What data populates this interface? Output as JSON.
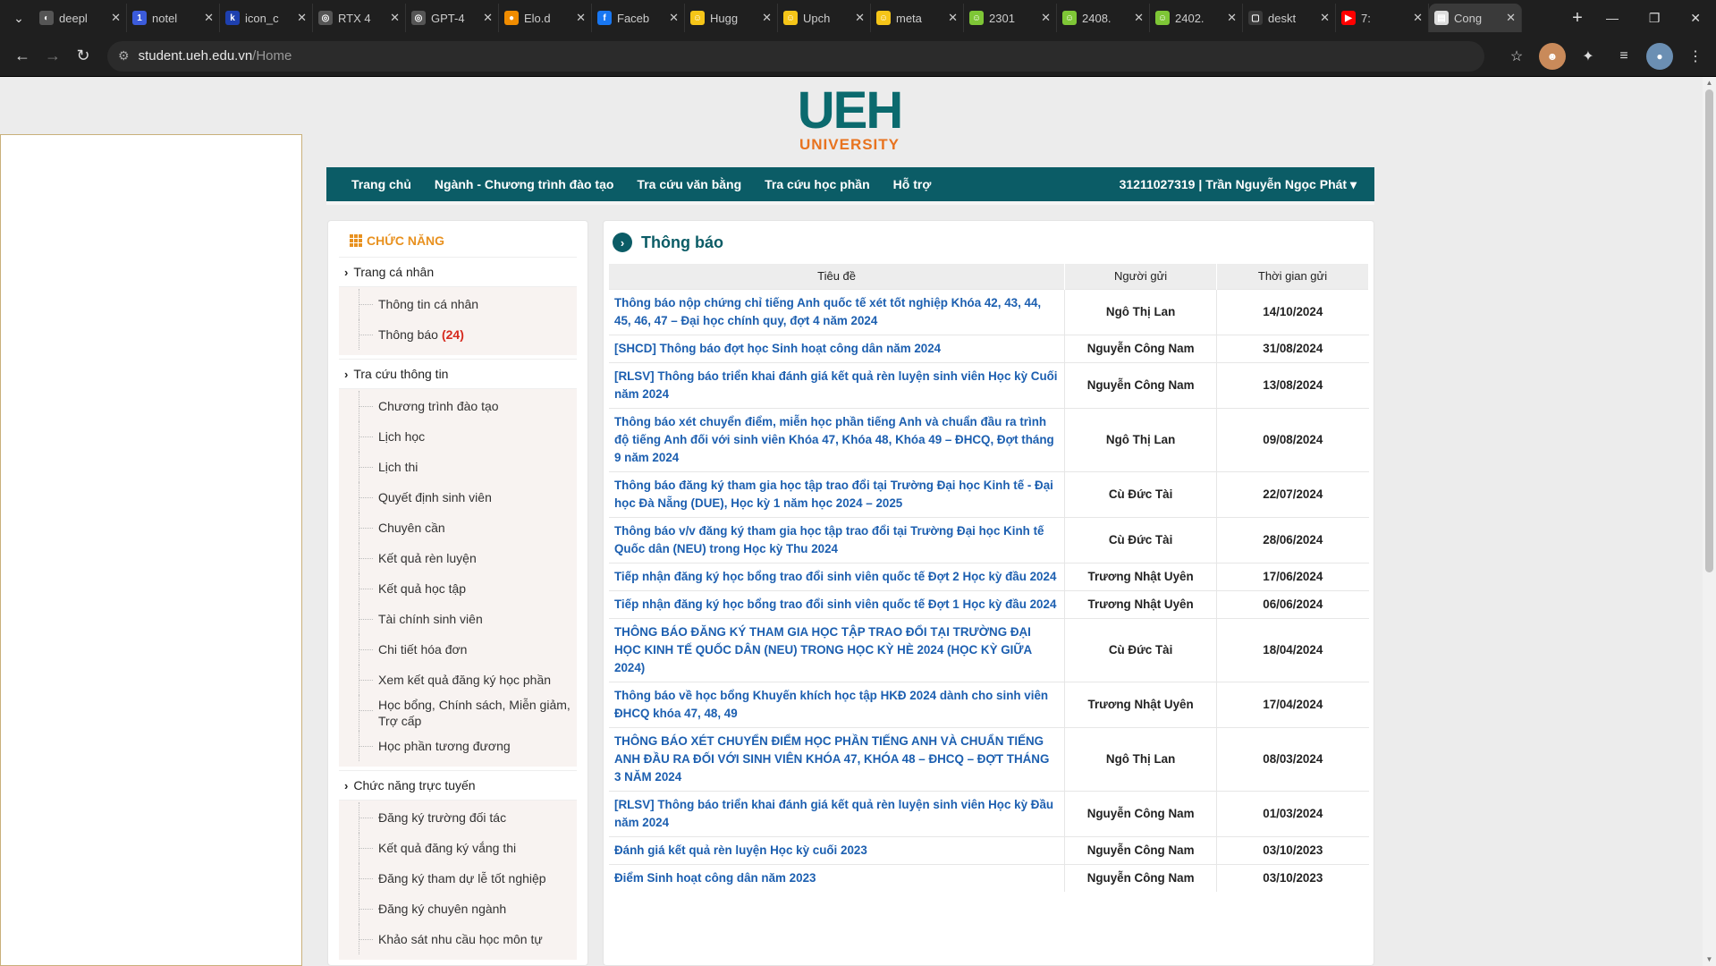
{
  "browser": {
    "tabs": [
      {
        "title": "deepl",
        "icon_color": "#555555",
        "icon_glyph": "◐"
      },
      {
        "title": "notel",
        "icon_color": "#3b5bdb",
        "icon_glyph": "1"
      },
      {
        "title": "icon_c",
        "icon_color": "#1e40af",
        "icon_glyph": "k"
      },
      {
        "title": "RTX 4",
        "icon_color": "#555555",
        "icon_glyph": "◎"
      },
      {
        "title": "GPT-4",
        "icon_color": "#555555",
        "icon_glyph": "◎"
      },
      {
        "title": "Elo.d",
        "icon_color": "#f08c00",
        "icon_glyph": "●"
      },
      {
        "title": "Faceb",
        "icon_color": "#1877f2",
        "icon_glyph": "f"
      },
      {
        "title": "Hugg",
        "icon_color": "#f5c518",
        "icon_glyph": "☺"
      },
      {
        "title": "Upch",
        "icon_color": "#f5c518",
        "icon_glyph": "☺"
      },
      {
        "title": "meta",
        "icon_color": "#f5c518",
        "icon_glyph": "☺"
      },
      {
        "title": "2301",
        "icon_color": "#7ec636",
        "icon_glyph": "☺"
      },
      {
        "title": "2408.",
        "icon_color": "#7ec636",
        "icon_glyph": "☺"
      },
      {
        "title": "2402.",
        "icon_color": "#7ec636",
        "icon_glyph": "☺"
      },
      {
        "title": "deskt",
        "icon_color": "#3a3a3a",
        "icon_glyph": "▢"
      },
      {
        "title": "7:",
        "icon_color": "#ff0000",
        "icon_glyph": "▶"
      },
      {
        "title": "Cong",
        "icon_color": "#dddddd",
        "icon_glyph": "▤"
      }
    ],
    "active_tab_index": 15,
    "url_host": "student.ueh.edu.vn",
    "url_path": "/Home"
  },
  "logo": {
    "line1": "UEH",
    "line2": "UNIVERSITY"
  },
  "nav": {
    "items": [
      "Trang chủ",
      "Ngành - Chương trình đào tạo",
      "Tra cứu văn bằng",
      "Tra cứu học phần",
      "Hỗ trợ"
    ],
    "user": "31211027319 | Trần Nguyễn Ngọc Phát"
  },
  "sidebar": {
    "title": "CHỨC NĂNG",
    "groups": [
      {
        "label": "Trang cá nhân",
        "items": [
          {
            "label": "Thông tin cá nhân",
            "badge": ""
          },
          {
            "label": "Thông báo",
            "badge": "(24)"
          }
        ]
      },
      {
        "label": "Tra cứu thông tin",
        "items": [
          {
            "label": "Chương trình đào tạo",
            "badge": ""
          },
          {
            "label": "Lịch học",
            "badge": ""
          },
          {
            "label": "Lịch thi",
            "badge": ""
          },
          {
            "label": "Quyết định sinh viên",
            "badge": ""
          },
          {
            "label": "Chuyên cần",
            "badge": ""
          },
          {
            "label": "Kết quả rèn luyện",
            "badge": ""
          },
          {
            "label": "Kết quả học tập",
            "badge": ""
          },
          {
            "label": "Tài chính sinh viên",
            "badge": ""
          },
          {
            "label": "Chi tiết hóa đơn",
            "badge": ""
          },
          {
            "label": "Xem kết quả đăng ký học phần",
            "badge": ""
          },
          {
            "label": "Học bổng, Chính sách, Miễn giảm, Trợ cấp",
            "badge": ""
          },
          {
            "label": "Học phần tương đương",
            "badge": ""
          }
        ]
      },
      {
        "label": "Chức năng trực tuyến",
        "items": [
          {
            "label": "Đăng ký trường đối tác",
            "badge": ""
          },
          {
            "label": "Kết quả đăng ký vắng thi",
            "badge": ""
          },
          {
            "label": "Đăng ký tham dự lễ tốt nghiệp",
            "badge": ""
          },
          {
            "label": "Đăng ký chuyên ngành",
            "badge": ""
          },
          {
            "label": "Khảo sát nhu cầu học môn tự",
            "badge": ""
          }
        ]
      }
    ]
  },
  "content": {
    "title": "Thông báo",
    "columns": [
      "Tiêu đề",
      "Người gửi",
      "Thời gian gửi"
    ],
    "rows": [
      {
        "title": "Thông báo nộp chứng chỉ tiếng Anh quốc tế xét tốt nghiệp Khóa 42, 43, 44, 45, 46, 47 – Đại học chính quy, đợt 4 năm 2024",
        "sender": "Ngô Thị Lan",
        "date": "14/10/2024"
      },
      {
        "title": "[SHCD] Thông báo đợt học Sinh hoạt công dân năm 2024",
        "sender": "Nguyễn Công Nam",
        "date": "31/08/2024"
      },
      {
        "title": "[RLSV] Thông báo triển khai đánh giá kết quả rèn luyện sinh viên Học kỳ Cuối năm 2024",
        "sender": "Nguyễn Công Nam",
        "date": "13/08/2024"
      },
      {
        "title": "Thông báo xét chuyển điểm, miễn học phần tiếng Anh và chuẩn đầu ra trình độ tiếng Anh đối với sinh viên Khóa 47, Khóa 48, Khóa 49 – ĐHCQ, Đợt tháng 9 năm 2024",
        "sender": "Ngô Thị Lan",
        "date": "09/08/2024"
      },
      {
        "title": "Thông báo đăng ký tham gia học tập trao đổi tại Trường Đại học Kinh tế - Đại học Đà Nẵng (DUE), Học kỳ 1 năm học 2024 – 2025",
        "sender": "Cù Đức Tài",
        "date": "22/07/2024"
      },
      {
        "title": "Thông báo v/v đăng ký tham gia học tập trao đổi tại Trường Đại học Kinh tế Quốc dân (NEU) trong Học kỳ Thu 2024",
        "sender": "Cù Đức Tài",
        "date": "28/06/2024"
      },
      {
        "title": "Tiếp nhận đăng ký học bổng trao đổi sinh viên quốc tế Đợt 2 Học kỳ đầu 2024",
        "sender": "Trương Nhật Uyên",
        "date": "17/06/2024"
      },
      {
        "title": "Tiếp nhận đăng ký học bổng trao đổi sinh viên quốc tế Đợt 1 Học kỳ đầu 2024",
        "sender": "Trương Nhật Uyên",
        "date": "06/06/2024"
      },
      {
        "title": "THÔNG BÁO ĐĂNG KÝ THAM GIA HỌC TẬP TRAO ĐỔI TẠI TRƯỜNG ĐẠI HỌC KINH TẾ QUỐC DÂN (NEU) TRONG HỌC KỲ HÈ 2024 (HỌC KỲ GIỮA 2024)",
        "sender": "Cù Đức Tài",
        "date": "18/04/2024"
      },
      {
        "title": "Thông báo về học bổng Khuyến khích học tập HKĐ 2024 dành cho sinh viên ĐHCQ khóa 47, 48, 49",
        "sender": "Trương Nhật Uyên",
        "date": "17/04/2024"
      },
      {
        "title": "THÔNG BÁO XÉT CHUYỂN ĐIỂM HỌC PHẦN TIẾNG ANH VÀ CHUẨN TIẾNG ANH ĐẦU RA ĐỐI VỚI SINH VIÊN KHÓA 47, KHÓA 48 – ĐHCQ – ĐỢT THÁNG 3 NĂM 2024",
        "sender": "Ngô Thị Lan",
        "date": "08/03/2024"
      },
      {
        "title": "[RLSV] Thông báo triển khai đánh giá kết quả rèn luyện sinh viên Học kỳ Đầu năm 2024",
        "sender": "Nguyễn Công Nam",
        "date": "01/03/2024"
      },
      {
        "title": "Đánh giá kết quả rèn luyện Học kỳ cuối 2023",
        "sender": "Nguyễn Công Nam",
        "date": "03/10/2023"
      },
      {
        "title": "Điểm Sinh hoạt công dân năm 2023",
        "sender": "Nguyễn Công Nam",
        "date": "03/10/2023"
      }
    ]
  },
  "colors": {
    "brand_teal": "#0b5c66",
    "brand_orange": "#e8731f",
    "link_blue": "#1c5fb0",
    "badge_red": "#d62a1e"
  }
}
